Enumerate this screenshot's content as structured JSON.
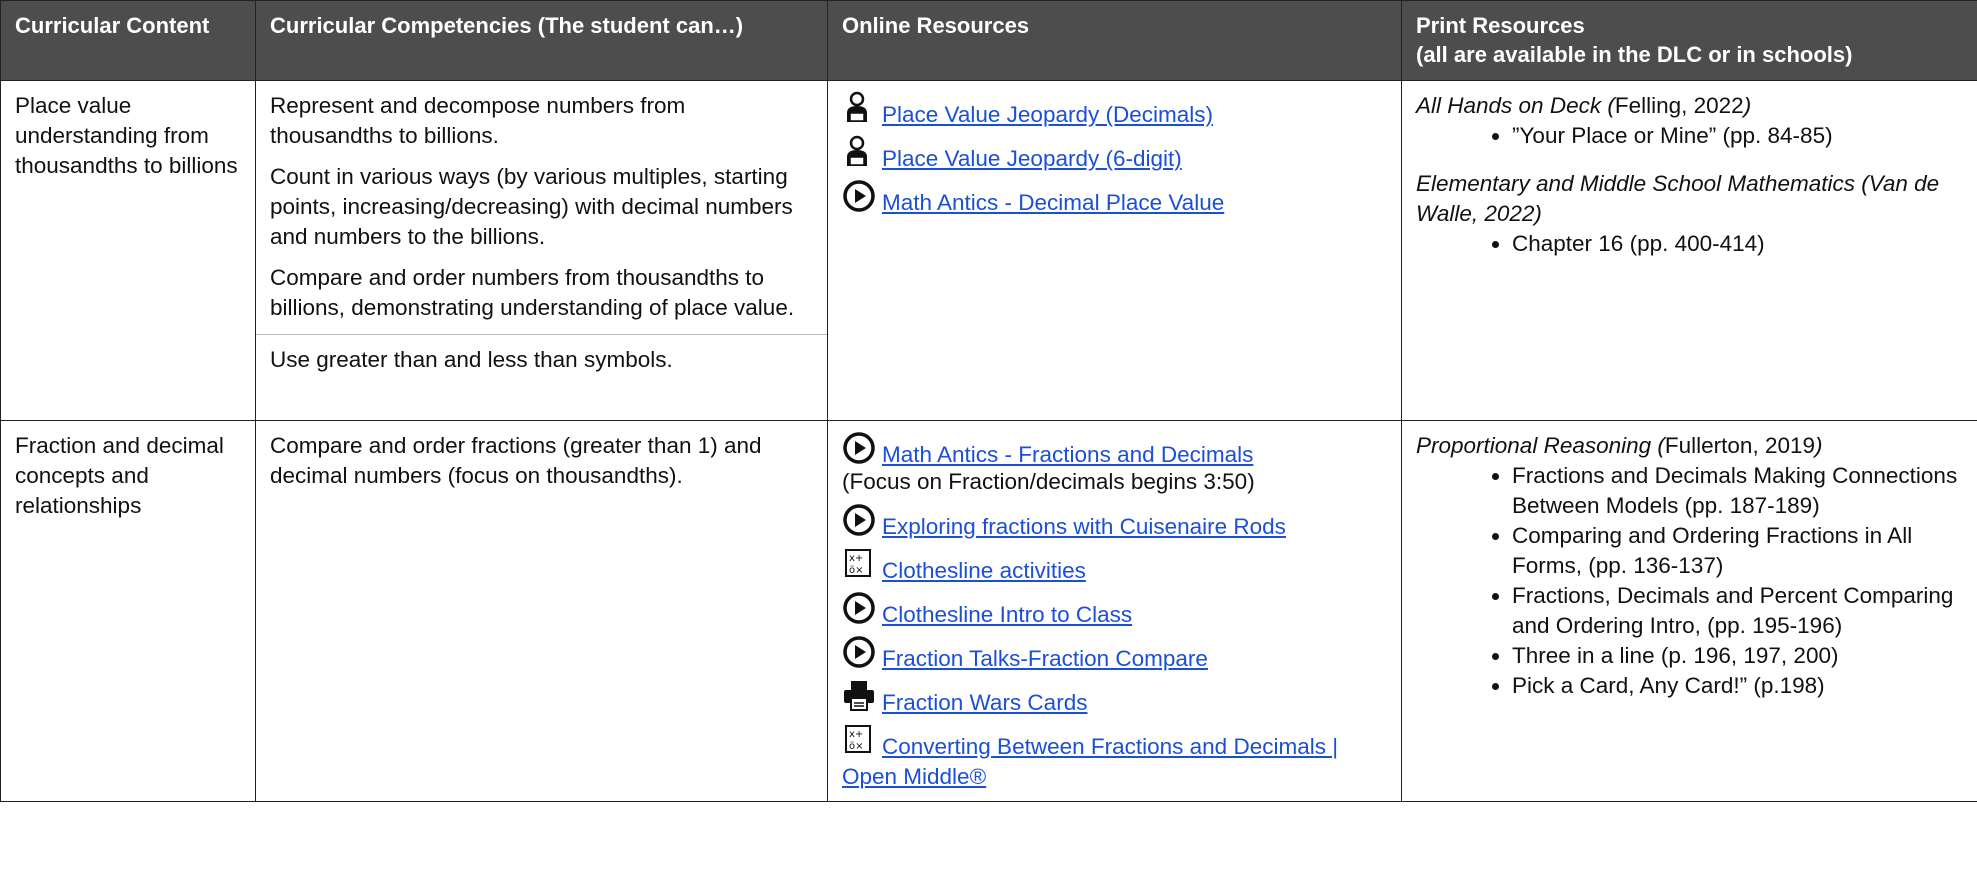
{
  "headers": {
    "col1": "Curricular Content",
    "col2": "Curricular Competencies (The student can…)",
    "col3": "Online Resources",
    "col4_line1": "Print Resources",
    "col4_line2": "(all are available in the DLC or in schools)"
  },
  "rows": [
    {
      "content": "Place value understanding from thousandths to billions",
      "competencies": [
        "Represent and decompose numbers from thousandths to billions.",
        "Count in various ways (by various multiples, starting points, increasing/decreasing) with decimal numbers and numbers to the billions.",
        "Compare and order numbers from thousandths to billions, demonstrating understanding of place value.",
        "Use greater than and less than symbols."
      ],
      "resources": [
        {
          "icon": "computer-user-icon",
          "label": "Place Value Jeopardy (Decimals)"
        },
        {
          "icon": "computer-user-icon",
          "label": "Place Value Jeopardy (6-digit)"
        },
        {
          "icon": "play-video-icon",
          "label": "Math Antics - Decimal Place Value"
        }
      ],
      "print": [
        {
          "title": "All Hands on Deck (",
          "author": "Felling, 2022",
          "close": ")",
          "items": [
            "”Your Place or Mine” (pp. 84-85)"
          ]
        },
        {
          "title": "Elementary and Middle School Mathematics (Van de Walle, 2022)",
          "items": [
            "Chapter 16 (pp. 400-414)"
          ]
        }
      ]
    },
    {
      "content": "Fraction and decimal concepts and relationships",
      "competencies": [
        "Compare and order fractions (greater than 1) and decimal numbers (focus on thousandths)."
      ],
      "resources": [
        {
          "icon": "play-video-icon",
          "label": "Math Antics - Fractions and Decimals",
          "note": "(Focus on Fraction/decimals begins 3:50)"
        },
        {
          "icon": "play-video-icon",
          "label": "Exploring fractions with Cuisenaire Rods"
        },
        {
          "icon": "math-worksheet-icon",
          "label": "Clothesline activities"
        },
        {
          "icon": "play-video-icon",
          "label": "Clothesline Intro to Class"
        },
        {
          "icon": "play-video-icon",
          "label": "Fraction Talks-Fraction Compare"
        },
        {
          "icon": "printer-icon",
          "label": "Fraction Wars Cards"
        },
        {
          "icon": "math-worksheet-icon",
          "label": "Converting Between Fractions and Decimals | Open Middle®"
        }
      ],
      "print": [
        {
          "title": "Proportional Reasoning (",
          "author": "Fullerton, 2019",
          "close": ")",
          "items": [
            "Fractions and Decimals Making Connections Between Models (pp. 187-189)",
            "Comparing and Ordering Fractions in All Forms, (pp. 136-137)",
            "Fractions, Decimals and Percent Comparing and Ordering Intro, (pp. 195-196)",
            "Three in a line (p. 196, 197, 200)",
            "Pick a Card, Any Card!” (p.198)"
          ]
        }
      ]
    }
  ]
}
